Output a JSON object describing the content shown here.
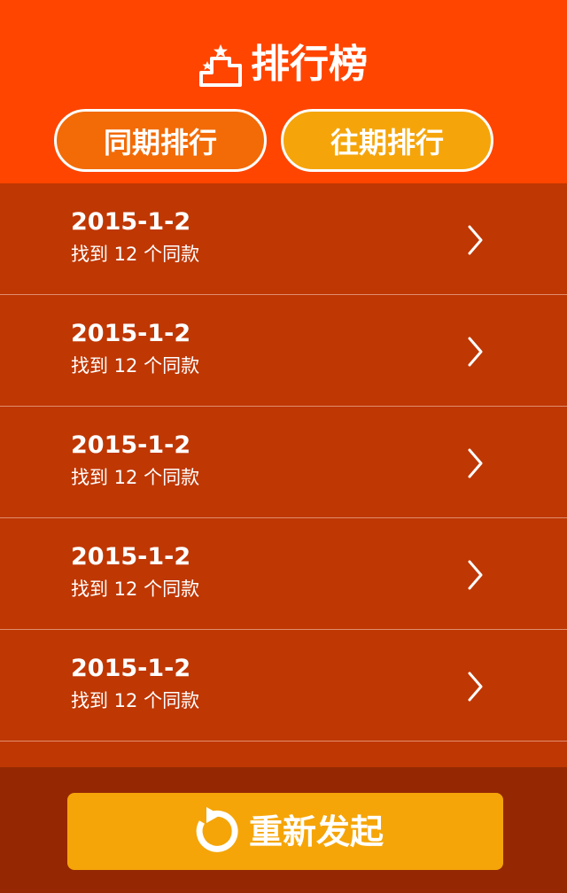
{
  "colors": {
    "header_bg": "#FF4500",
    "list_bg": "#BF3703",
    "footer_bg": "#952803",
    "tab_active_bg": "#F26B07",
    "tab_inactive_bg": "#F5A50A",
    "button_bg": "#F5A508",
    "text": "#FFFFFF"
  },
  "header": {
    "title": "排行榜",
    "icon": "podium-icon",
    "tabs": [
      {
        "label": "同期排行"
      },
      {
        "label": "往期排行"
      }
    ]
  },
  "list": {
    "items": [
      {
        "date": "2015-1-2",
        "subtitle": "找到 12 个同款"
      },
      {
        "date": "2015-1-2",
        "subtitle": "找到 12 个同款"
      },
      {
        "date": "2015-1-2",
        "subtitle": "找到 12 个同款"
      },
      {
        "date": "2015-1-2",
        "subtitle": "找到 12 个同款"
      },
      {
        "date": "2015-1-2",
        "subtitle": "找到 12 个同款"
      }
    ]
  },
  "footer": {
    "button_label": "重新发起",
    "button_icon": "refresh-icon"
  }
}
